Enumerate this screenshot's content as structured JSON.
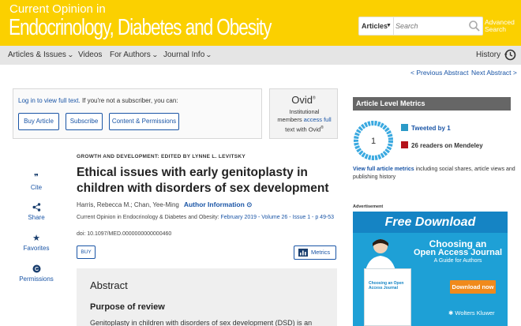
{
  "header": {
    "brand_line1": "Current Opinion in",
    "brand_line2": "Endocrinology, Diabetes and Obesity",
    "search_category": "Articles",
    "search_placeholder": "Search",
    "advanced_search_1": "Advanced",
    "advanced_search_2": "Search"
  },
  "nav": {
    "items": [
      {
        "label": "Articles & Issues",
        "has_menu": true
      },
      {
        "label": "Videos",
        "has_menu": false
      },
      {
        "label": "For Authors",
        "has_menu": true
      },
      {
        "label": "Journal Info",
        "has_menu": true
      }
    ],
    "history_label": "History"
  },
  "pager": {
    "prev": "< Previous Abstract",
    "next": "Next Abstract >"
  },
  "access": {
    "login_link": "Log in to view full text.",
    "login_rest": " If you're not a subscriber, you can:",
    "buttons": [
      "Buy Article",
      "Subscribe",
      "Content & Permissions"
    ]
  },
  "ovid": {
    "logo": "Ovid",
    "logo_mark": "®",
    "line1": "Institutional",
    "line2_plain": "members ",
    "line2_link": "access full",
    "line3": "text with Ovid",
    "line3_mark": "®"
  },
  "tools": [
    "Cite",
    "Share",
    "Favorites",
    "Permissions"
  ],
  "article": {
    "section": "GROWTH AND DEVELOPMENT: EDITED BY LYNNE L. LEVITSKY",
    "title": "Ethical issues with early genitoplasty in children with disorders of sex development",
    "authors": "Harris, Rebecca M.; Chan, Yee-Ming",
    "author_info": "Author Information",
    "citation_plain": "Current Opinion in Endocrinology & Diabetes and Obesity: ",
    "citation_link": "February 2019 - Volume 26 - Issue 1 - p 49-53",
    "doi": "doi: 10.1097/MED.0000000000000460",
    "buy": "BUY",
    "metrics": "Metrics"
  },
  "abstract": {
    "heading": "Abstract",
    "subheading": "Purpose of review",
    "text": "Genitoplasty in children with disorders of sex development (DSD) is an"
  },
  "metrics_panel": {
    "heading": "Article Level Metrics",
    "altmetric_score": "1",
    "tweeted": "Tweeted by 1",
    "mendeley": "26 readers on Mendeley",
    "full_link": "View full article metrics",
    "full_rest": " including social shares, article views and publishing history",
    "colors": {
      "twitter": "#2b9ac7",
      "mendeley": "#b4121a",
      "ring": "#3aa9e0"
    }
  },
  "ad": {
    "label": "Advertisement",
    "banner": "Free Download",
    "line1": "Choosing an",
    "line2": "Open Access Journal",
    "line3": "A Guide for Authors",
    "download": "Download now",
    "brand": "Wolters Kluwer",
    "book_title": "Choosing an Open Access Journal"
  },
  "colors": {
    "header": "#fbd000",
    "nav": "#e5e5e5",
    "link": "#1a55a6",
    "metrics_head": "#666666",
    "ad_bg": "#1ea0d6"
  }
}
